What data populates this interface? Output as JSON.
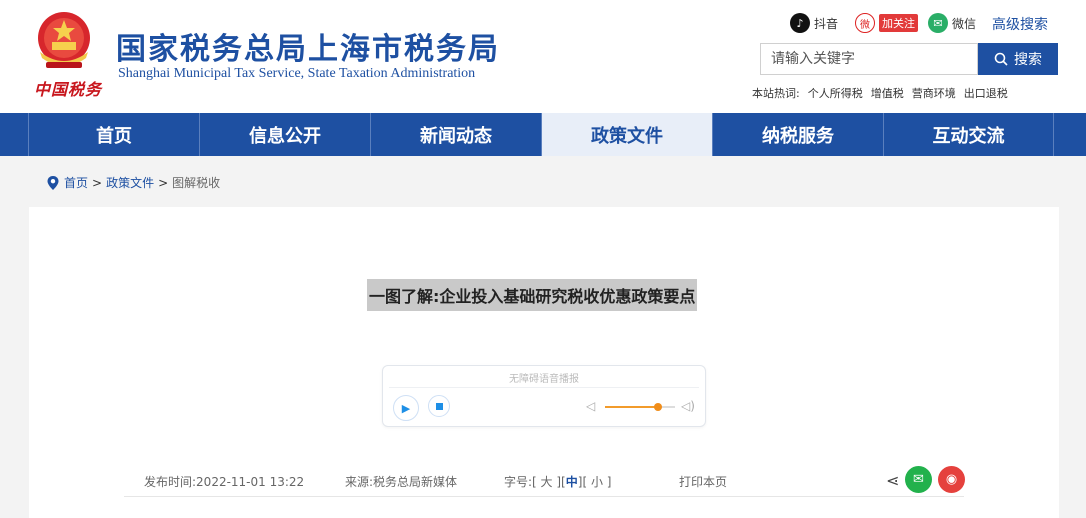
{
  "header": {
    "title_cn": "国家税务总局上海市税务局",
    "title_en": "Shanghai Municipal Tax Service, State Taxation Administration",
    "brand_script": "中国税务"
  },
  "social": {
    "douyin": "抖音",
    "weibo_follow": "加关注",
    "wechat": "微信",
    "advanced_search": "高级搜索"
  },
  "search": {
    "placeholder": "请输入关键字",
    "button": "搜索"
  },
  "hot": {
    "label": "本站热词:",
    "items": [
      "个人所得税",
      "增值税",
      "营商环境",
      "出口退税"
    ]
  },
  "nav": {
    "items": [
      "首页",
      "信息公开",
      "新闻动态",
      "政策文件",
      "纳税服务",
      "互动交流"
    ],
    "active": "政策文件"
  },
  "breadcrumb": {
    "home": "首页",
    "sep": ">",
    "section": "政策文件",
    "current": "图解税收"
  },
  "article": {
    "title": "一图了解:企业投入基础研究税收优惠政策要点"
  },
  "audio": {
    "label": "无障碍语音播报",
    "volume": 0.75
  },
  "meta": {
    "published": "发布时间:2022-11-01 13:22",
    "source": "来源:税务总局新媒体",
    "font_label": "字号:",
    "font_large": "大",
    "font_medium": "中",
    "font_small": "小",
    "print": "打印本页"
  },
  "colors": {
    "brand_blue": "#1e50a2",
    "accent_red": "#c8161d",
    "wechat_green": "#22b14c",
    "weibo_red": "#e5413d"
  }
}
